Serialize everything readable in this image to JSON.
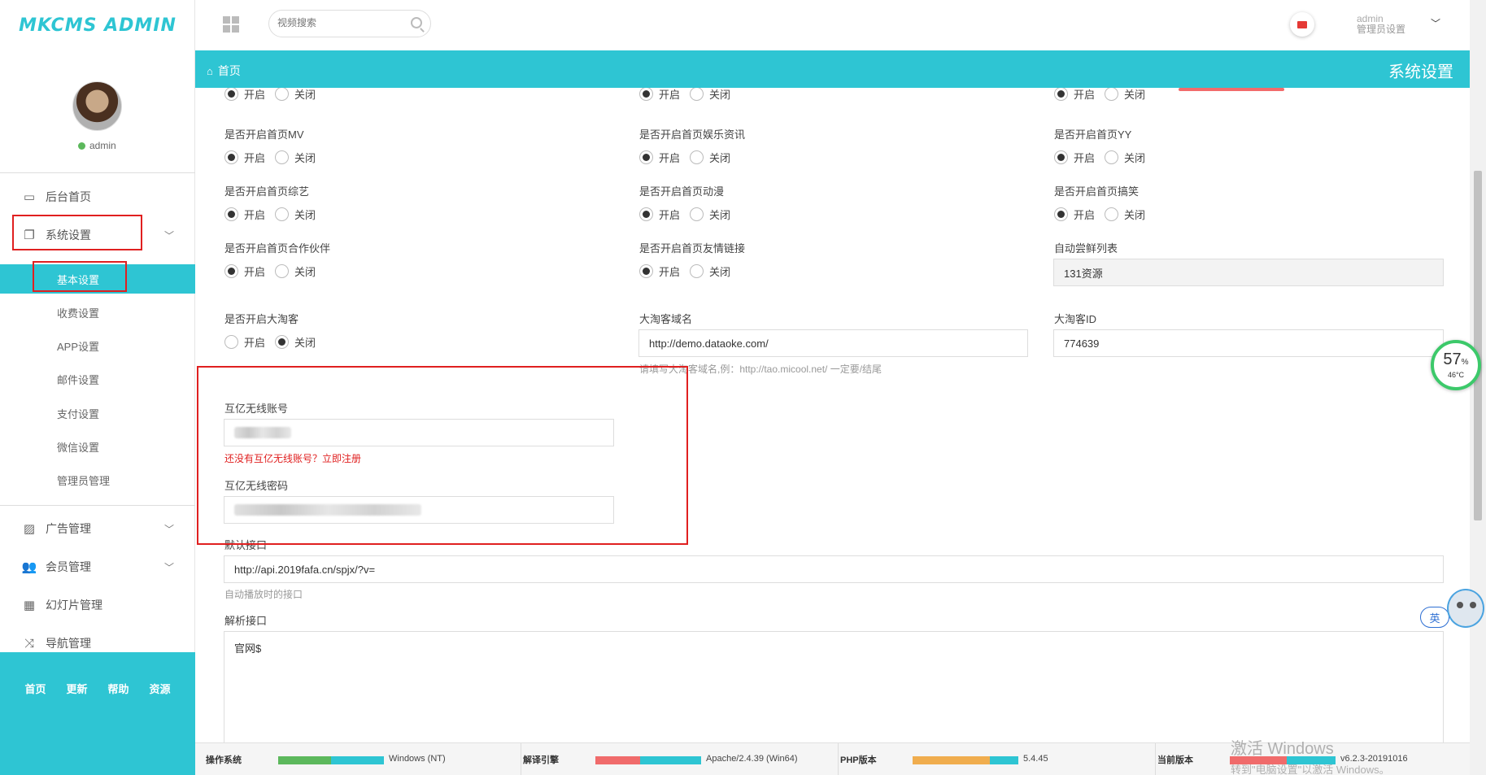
{
  "app": {
    "logo_text": "MKCMS ADMIN"
  },
  "user": {
    "name": "admin",
    "status": "admin",
    "role": "管理员设置"
  },
  "search": {
    "placeholder": "视频搜索"
  },
  "breadcrumb": {
    "home": "首页"
  },
  "page_title": "系统设置",
  "sidebar": {
    "items": [
      {
        "label": "后台首页",
        "icon": "laptop-icon"
      },
      {
        "label": "系统设置",
        "icon": "copy-icon",
        "expanded": true
      },
      {
        "label": "广告管理",
        "icon": "image-icon"
      },
      {
        "label": "会员管理",
        "icon": "users-icon"
      },
      {
        "label": "幻灯片管理",
        "icon": "table-icon"
      },
      {
        "label": "导航管理",
        "icon": "shuffle-icon"
      }
    ],
    "sub_items": [
      "基本设置",
      "收费设置",
      "APP设置",
      "邮件设置",
      "支付设置",
      "微信设置",
      "管理员管理"
    ],
    "footer_links": [
      "首页",
      "更新",
      "帮助",
      "资源"
    ]
  },
  "radio": {
    "on": "开启",
    "off": "关闭"
  },
  "form": {
    "mv_label": "是否开启首页MV",
    "ent_label": "是否开启首页娱乐资讯",
    "yy_label": "是否开启首页YY",
    "variety_label": "是否开启首页综艺",
    "anime_label": "是否开启首页动漫",
    "funny_label": "是否开启首页搞笑",
    "partner_label": "是否开启首页合作伙伴",
    "friendlink_label": "是否开启首页友情链接",
    "autocollect_label": "自动尝鲜列表",
    "autocollect_value": "131资源",
    "dtk_label": "是否开启大淘客",
    "dtk_domain_label": "大淘客域名",
    "dtk_domain_value": "http://demo.dataoke.com/",
    "dtk_domain_hint": "请填写大淘客域名,例：http://tao.micool.net/ 一定要/结尾",
    "dtk_id_label": "大淘客ID",
    "dtk_id_value": "774639",
    "huyi_account_label": "互亿无线账号",
    "huyi_register_link": "还没有互亿无线账号？立即注册",
    "huyi_password_label": "互亿无线密码",
    "default_api_label": "默认接口",
    "default_api_value": "http://api.2019fafa.cn/spjx/?v=",
    "default_api_hint": "自动播放时的接口",
    "parse_api_label": "解析接口",
    "parse_api_value": "官网$"
  },
  "status": {
    "os_label": "操作系统",
    "os_value": "Windows (NT)",
    "engine_label": "解译引擎",
    "engine_value": "Apache/2.4.39 (Win64)",
    "php_label": "PHP版本",
    "php_value": "5.4.45",
    "version_label": "当前版本",
    "version_value": "v6.2.3-20191016"
  },
  "overlay": {
    "gauge_percent": "57",
    "gauge_unit": "%",
    "gauge_temp": "46°C",
    "ime_label": "英",
    "watermark_line1": "激活 Windows",
    "watermark_line2": "转到\"电脑设置\"以激活 Windows。"
  },
  "colors": {
    "accent": "#2ec5d3",
    "highlight_box": "#e02020"
  }
}
